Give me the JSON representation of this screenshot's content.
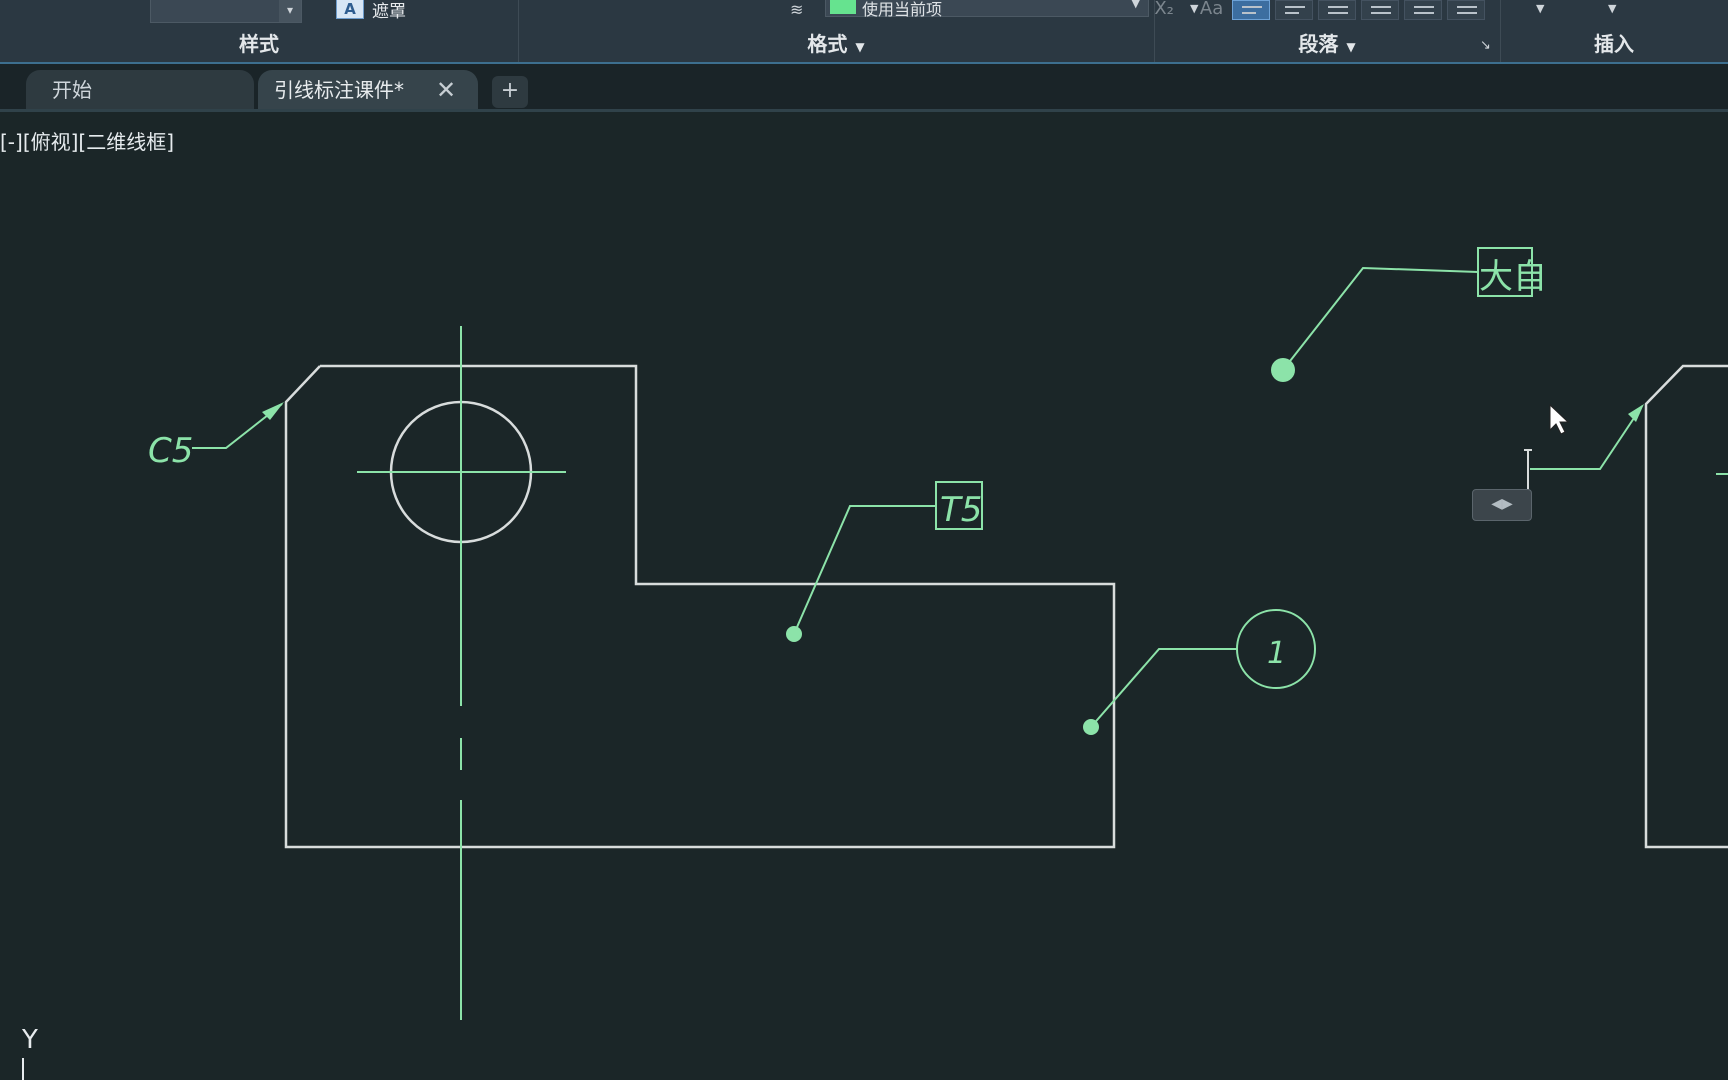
{
  "ribbon": {
    "panels": {
      "style": "样式",
      "format": "格式",
      "paragraph": "段落",
      "insert": "插入"
    },
    "mask_label": "遮罩",
    "mask_icon_letter": "A",
    "format_icons": [
      "X",
      "X₂",
      "Aa"
    ],
    "color_combo_value": "使用当前项",
    "accent_color": "#66e38f"
  },
  "tabs": [
    {
      "label": "开始"
    },
    {
      "label": "引线标注课件*"
    }
  ],
  "tab_add_label": "+",
  "tab_close_label": "✕",
  "viewport_label": "[-][俯视][二维线框]",
  "drawing": {
    "annotations": {
      "chamfer": "C5",
      "surface": "T5",
      "balloon": "1",
      "boxed_text": "大自"
    }
  },
  "grip_widget_label": "◀▶",
  "ucs_label": "Y"
}
